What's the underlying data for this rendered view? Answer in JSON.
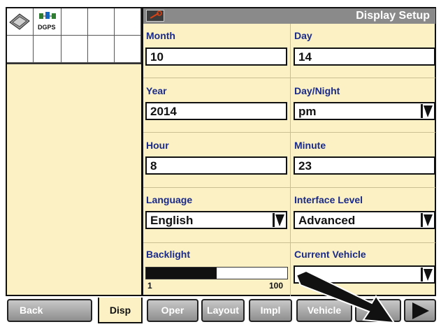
{
  "status_bar": {
    "dgps_label": "DGPS"
  },
  "header": {
    "title": "Display Setup"
  },
  "fields": {
    "month": {
      "label": "Month",
      "value": "10"
    },
    "day": {
      "label": "Day",
      "value": "14"
    },
    "year": {
      "label": "Year",
      "value": "2014"
    },
    "day_night": {
      "label": "Day/Night",
      "value": "pm"
    },
    "hour": {
      "label": "Hour",
      "value": "8"
    },
    "minute": {
      "label": "Minute",
      "value": "23"
    },
    "language": {
      "label": "Language",
      "value": "English"
    },
    "interface_level": {
      "label": "Interface Level",
      "value": "Advanced"
    },
    "backlight": {
      "label": "Backlight",
      "min_label": "1",
      "max_label": "100",
      "level_fraction": 0.5
    },
    "current_vehicle": {
      "label": "Current Vehicle",
      "value": ""
    }
  },
  "bottom_bar": {
    "back": "Back",
    "disp": "Disp",
    "oper": "Oper",
    "layout": "Layout",
    "impl": "Impl",
    "vehicle": "Vehicle",
    "vt": "VT"
  },
  "colors": {
    "panel_bg": "#fbf1c4",
    "label_blue": "#1a2a8a",
    "title_bar": "#8a8a8a"
  }
}
